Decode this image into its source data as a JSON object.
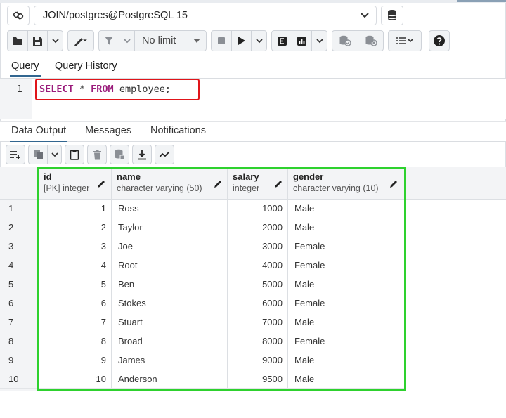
{
  "connection": {
    "label": "JOIN/postgres@PostgreSQL 15"
  },
  "toolbar": {
    "limit_label": "No limit"
  },
  "query_tabs": [
    "Query",
    "Query History"
  ],
  "editor": {
    "line_number": "1",
    "kw1": "SELECT",
    "rest1": " * ",
    "kw2": "FROM",
    "rest2": " employee;"
  },
  "result_tabs": [
    "Data Output",
    "Messages",
    "Notifications"
  ],
  "columns": [
    {
      "name": "id",
      "type": "[PK] integer"
    },
    {
      "name": "name",
      "type": "character varying (50)"
    },
    {
      "name": "salary",
      "type": "integer"
    },
    {
      "name": "gender",
      "type": "character varying (10)"
    }
  ],
  "rows": [
    {
      "n": "1",
      "id": "1",
      "name": "Ross",
      "salary": "1000",
      "gender": "Male"
    },
    {
      "n": "2",
      "id": "2",
      "name": "Taylor",
      "salary": "2000",
      "gender": "Male"
    },
    {
      "n": "3",
      "id": "3",
      "name": "Joe",
      "salary": "3000",
      "gender": "Female"
    },
    {
      "n": "4",
      "id": "4",
      "name": "Root",
      "salary": "4000",
      "gender": "Female"
    },
    {
      "n": "5",
      "id": "5",
      "name": "Ben",
      "salary": "5000",
      "gender": "Male"
    },
    {
      "n": "6",
      "id": "6",
      "name": "Stokes",
      "salary": "6000",
      "gender": "Female"
    },
    {
      "n": "7",
      "id": "7",
      "name": "Stuart",
      "salary": "7000",
      "gender": "Male"
    },
    {
      "n": "8",
      "id": "8",
      "name": "Broad",
      "salary": "8000",
      "gender": "Female"
    },
    {
      "n": "9",
      "id": "9",
      "name": "James",
      "salary": "9000",
      "gender": "Male"
    },
    {
      "n": "10",
      "id": "10",
      "name": "Anderson",
      "salary": "9500",
      "gender": "Male"
    }
  ],
  "colors": {
    "sql_highlight_box": "#e0151a",
    "grid_highlight_box": "#2ed12e",
    "keyword": "#9a1b7b",
    "tab_underline": "#326690"
  }
}
